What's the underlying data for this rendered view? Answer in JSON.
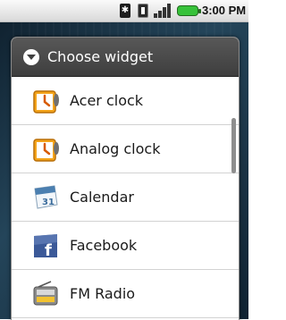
{
  "status_bar": {
    "time": "3:00 PM",
    "icons": [
      "bluetooth-icon",
      "vibrate-icon",
      "signal-icon",
      "battery-icon"
    ],
    "battery_color": "#37c23a"
  },
  "dialog": {
    "title": "Choose widget",
    "title_icon": "chevron-down-icon",
    "header_color": "#4a4a4a",
    "items": [
      {
        "label": "Acer clock",
        "icon": "clock-icon"
      },
      {
        "label": "Analog clock",
        "icon": "clock-icon"
      },
      {
        "label": "Calendar",
        "icon": "calendar-icon",
        "icon_text": "31"
      },
      {
        "label": "Facebook",
        "icon": "facebook-icon",
        "icon_text": "f"
      },
      {
        "label": "FM Radio",
        "icon": "radio-icon"
      }
    ]
  }
}
